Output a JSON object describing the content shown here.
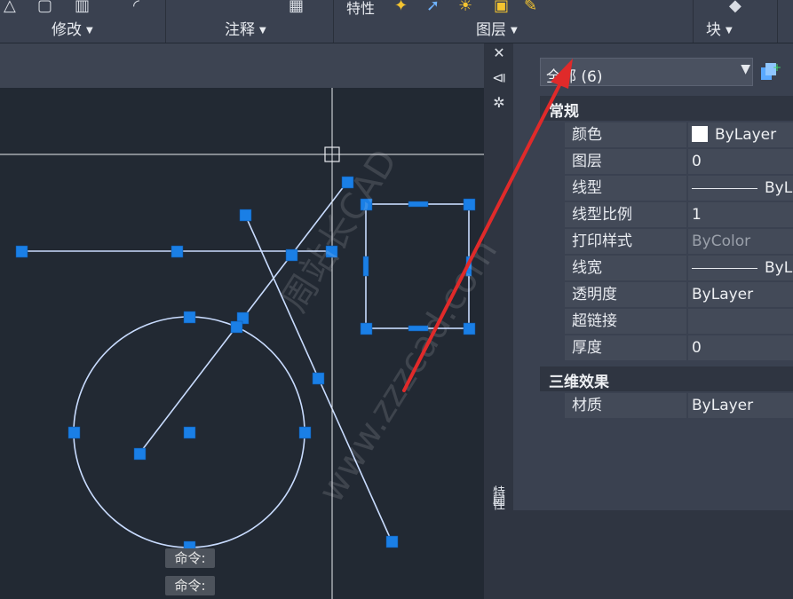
{
  "ribbon": {
    "groups": [
      {
        "label": "修改"
      },
      {
        "label": "注释"
      },
      {
        "label": "图层"
      },
      {
        "label": "块"
      }
    ],
    "top_label": "特性"
  },
  "command_lines": [
    "命令:",
    "命令:"
  ],
  "strip": {
    "vertical_title": "特性"
  },
  "properties": {
    "selection": "全部 (6)",
    "sections": [
      {
        "title": "常规",
        "rows": [
          {
            "name": "颜色",
            "value": "ByLayer"
          },
          {
            "name": "图层",
            "value": "0"
          },
          {
            "name": "线型",
            "value": "ByLa"
          },
          {
            "name": "线型比例",
            "value": "1"
          },
          {
            "name": "打印样式",
            "value": "ByColor"
          },
          {
            "name": "线宽",
            "value": "ByLa"
          },
          {
            "name": "透明度",
            "value": "ByLayer"
          },
          {
            "name": "超链接",
            "value": ""
          },
          {
            "name": "厚度",
            "value": "0"
          }
        ]
      },
      {
        "title": "三维效果",
        "rows": [
          {
            "name": "材质",
            "value": "ByLayer"
          }
        ]
      }
    ]
  },
  "watermark": {
    "line1": "周站长CAD",
    "line2": "www.zzzcad.com"
  },
  "colors": {
    "grip": "#1a7fe6",
    "entity": "#c9dcff",
    "arrow": "#e02a2a"
  }
}
